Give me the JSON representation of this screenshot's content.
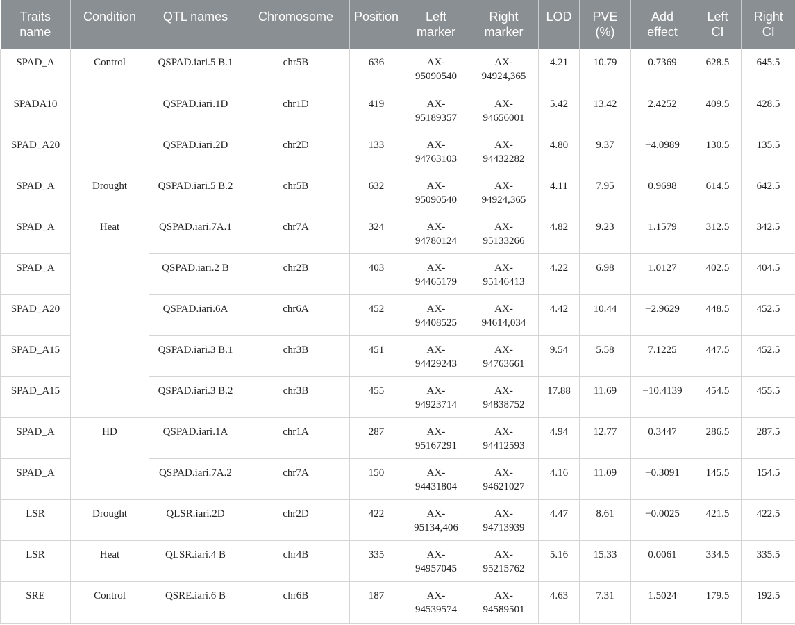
{
  "table": {
    "headers": [
      [
        "Traits",
        "name"
      ],
      [
        "Condition"
      ],
      [
        "QTL names"
      ],
      [
        "Chromosome"
      ],
      [
        "Position"
      ],
      [
        "Left",
        "marker"
      ],
      [
        "Right",
        "marker"
      ],
      [
        "LOD"
      ],
      [
        "PVE",
        "(%)"
      ],
      [
        "Add",
        "effect"
      ],
      [
        "Left",
        "CI"
      ],
      [
        "Right",
        "CI"
      ]
    ],
    "condition_groups": [
      {
        "label": "Control",
        "start": 0,
        "span": 3
      },
      {
        "label": "Drought",
        "start": 3,
        "span": 1
      },
      {
        "label": "Heat",
        "start": 4,
        "span": 5
      },
      {
        "label": "HD",
        "start": 9,
        "span": 2
      },
      {
        "label": "Drought",
        "start": 11,
        "span": 1
      },
      {
        "label": "Heat",
        "start": 12,
        "span": 1
      },
      {
        "label": "Control",
        "start": 13,
        "span": 1
      }
    ],
    "rows": [
      {
        "trait": "SPAD_A",
        "qtl": "QSPAD.iari.5 B.1",
        "chrom": "chr5B",
        "position": "636",
        "left_marker": [
          "AX-",
          "95090540"
        ],
        "right_marker": [
          "AX-",
          "94924,365"
        ],
        "lod": "4.21",
        "pve": "10.79",
        "add_effect": "0.7369",
        "left_ci": "628.5",
        "right_ci": "645.5"
      },
      {
        "trait": "SPADA10",
        "qtl": "QSPAD.iari.1D",
        "chrom": "chr1D",
        "position": "419",
        "left_marker": [
          "AX-",
          "95189357"
        ],
        "right_marker": [
          "AX-",
          "94656001"
        ],
        "lod": "5.42",
        "pve": "13.42",
        "add_effect": "2.4252",
        "left_ci": "409.5",
        "right_ci": "428.5"
      },
      {
        "trait": "SPAD_A20",
        "qtl": "QSPAD.iari.2D",
        "chrom": "chr2D",
        "position": "133",
        "left_marker": [
          "AX-",
          "94763103"
        ],
        "right_marker": [
          "AX-",
          "94432282"
        ],
        "lod": "4.80",
        "pve": "9.37",
        "add_effect": "−4.0989",
        "left_ci": "130.5",
        "right_ci": "135.5"
      },
      {
        "trait": "SPAD_A",
        "qtl": "QSPAD.iari.5 B.2",
        "chrom": "chr5B",
        "position": "632",
        "left_marker": [
          "AX-",
          "95090540"
        ],
        "right_marker": [
          "AX-",
          "94924,365"
        ],
        "lod": "4.11",
        "pve": "7.95",
        "add_effect": "0.9698",
        "left_ci": "614.5",
        "right_ci": "642.5"
      },
      {
        "trait": "SPAD_A",
        "qtl": "QSPAD.iari.7A.1",
        "chrom": "chr7A",
        "position": "324",
        "left_marker": [
          "AX-",
          "94780124"
        ],
        "right_marker": [
          "AX-",
          "95133266"
        ],
        "lod": "4.82",
        "pve": "9.23",
        "add_effect": "1.1579",
        "left_ci": "312.5",
        "right_ci": "342.5"
      },
      {
        "trait": "SPAD_A",
        "qtl": "QSPAD.iari.2 B",
        "chrom": "chr2B",
        "position": "403",
        "left_marker": [
          "AX-",
          "94465179"
        ],
        "right_marker": [
          "AX-",
          "95146413"
        ],
        "lod": "4.22",
        "pve": "6.98",
        "add_effect": "1.0127",
        "left_ci": "402.5",
        "right_ci": "404.5"
      },
      {
        "trait": "SPAD_A20",
        "qtl": "QSPAD.iari.6A",
        "chrom": "chr6A",
        "position": "452",
        "left_marker": [
          "AX-",
          "94408525"
        ],
        "right_marker": [
          "AX-",
          "94614,034"
        ],
        "lod": "4.42",
        "pve": "10.44",
        "add_effect": "−2.9629",
        "left_ci": "448.5",
        "right_ci": "452.5"
      },
      {
        "trait": "SPAD_A15",
        "qtl": "QSPAD.iari.3 B.1",
        "chrom": "chr3B",
        "position": "451",
        "left_marker": [
          "AX-",
          "94429243"
        ],
        "right_marker": [
          "AX-",
          "94763661"
        ],
        "lod": "9.54",
        "pve": "5.58",
        "add_effect": "7.1225",
        "left_ci": "447.5",
        "right_ci": "452.5"
      },
      {
        "trait": "SPAD_A15",
        "qtl": "QSPAD.iari.3 B.2",
        "chrom": "chr3B",
        "position": "455",
        "left_marker": [
          "AX-",
          "94923714"
        ],
        "right_marker": [
          "AX-",
          "94838752"
        ],
        "lod": "17.88",
        "pve": "11.69",
        "add_effect": "−10.4139",
        "left_ci": "454.5",
        "right_ci": "455.5"
      },
      {
        "trait": "SPAD_A",
        "qtl": "QSPAD.iari.1A",
        "chrom": "chr1A",
        "position": "287",
        "left_marker": [
          "AX-",
          "95167291"
        ],
        "right_marker": [
          "AX-",
          "94412593"
        ],
        "lod": "4.94",
        "pve": "12.77",
        "add_effect": "0.3447",
        "left_ci": "286.5",
        "right_ci": "287.5"
      },
      {
        "trait": "SPAD_A",
        "qtl": "QSPAD.iari.7A.2",
        "chrom": "chr7A",
        "position": "150",
        "left_marker": [
          "AX-",
          "94431804"
        ],
        "right_marker": [
          "AX-",
          "94621027"
        ],
        "lod": "4.16",
        "pve": "11.09",
        "add_effect": "−0.3091",
        "left_ci": "145.5",
        "right_ci": "154.5"
      },
      {
        "trait": "LSR",
        "qtl": "QLSR.iari.2D",
        "chrom": "chr2D",
        "position": "422",
        "left_marker": [
          "AX-",
          "95134,406"
        ],
        "right_marker": [
          "AX-",
          "94713939"
        ],
        "lod": "4.47",
        "pve": "8.61",
        "add_effect": "−0.0025",
        "left_ci": "421.5",
        "right_ci": "422.5"
      },
      {
        "trait": "LSR",
        "qtl": "QLSR.iari.4 B",
        "chrom": "chr4B",
        "position": "335",
        "left_marker": [
          "AX-",
          "94957045"
        ],
        "right_marker": [
          "AX-",
          "95215762"
        ],
        "lod": "5.16",
        "pve": "15.33",
        "add_effect": "0.0061",
        "left_ci": "334.5",
        "right_ci": "335.5"
      },
      {
        "trait": "SRE",
        "qtl": "QSRE.iari.6 B",
        "chrom": "chr6B",
        "position": "187",
        "left_marker": [
          "AX-",
          "94539574"
        ],
        "right_marker": [
          "AX-",
          "94589501"
        ],
        "lod": "4.63",
        "pve": "7.31",
        "add_effect": "1.5024",
        "left_ci": "179.5",
        "right_ci": "192.5"
      }
    ]
  },
  "colors": {
    "header_bg": "#8a8f93",
    "header_text": "#ffffff",
    "grid_line": "#d5d5d5"
  }
}
